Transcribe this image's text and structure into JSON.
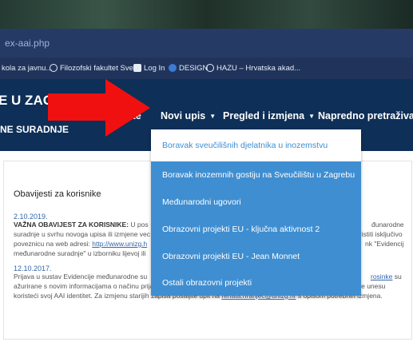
{
  "browser": {
    "url_fragment": "ex-aai.php",
    "bookmarks": [
      {
        "label": "kola za javnu...",
        "icon": "bookmark-icon"
      },
      {
        "label": "Filozofski fakultet Sve...",
        "icon": "globe-icon"
      },
      {
        "label": "Log In",
        "icon": "login-page-icon"
      },
      {
        "label": "DESIGN",
        "icon": "design-icon"
      },
      {
        "label": "HAZU – Hrvatska akad...",
        "icon": "hazu-icon"
      }
    ]
  },
  "header": {
    "title": "E U ZAGREB",
    "subtitle": "NE SURADNJE",
    "nav": {
      "partial": "ute",
      "novi_upis": "Novi upis",
      "pregled": "Pregled i izmjena",
      "napredno": "Napredno pretraživanje"
    }
  },
  "dropdown": {
    "items": [
      "Boravak sveučilišnih djelatnika u inozemstvu",
      "Boravak inozemnih gostiju na Sveučilištu u Zagrebu",
      "Međunarodni ugovori",
      "Obrazovni projekti EU - ključna aktivnost 2",
      "Obrazovni projekti EU - Jean Monnet",
      "Ostali obrazovni projekti"
    ]
  },
  "notices": {
    "title": "Obavijesti za korisnike",
    "n1": {
      "date": "2.10.2019.",
      "bold": "VAŽNA OBAVIJEST ZA KORISNIKE:",
      "line1_rest": " U pos",
      "line1_right": "đunarodne",
      "line2_left": "suradnje u svrhu novoga upisa ili izmjene vec",
      "line2_right": "oristiti isključivo",
      "line3_left": "poveznicu na web adresi: ",
      "line3_link": "http://www.unizg.h",
      "line3_right": "nk \"Evidencija",
      "line4": "međunarodne suradnje\" u izborniku lijevoj ili"
    },
    "n2": {
      "date": "12.10.2017.",
      "line1_left": "Prijava u sustav Evidencije međunarodne su",
      "line1_link": "rosinke",
      "line1_right": " su",
      "line2": "ažurirane s novim informacijama o načinu prijave. Korisnici će biti u mogućnosti samostalno izmijeniti sve zapise koje unesu",
      "line3_left": "koristeći svoj AAI identitet. Za izmjenu starijih zapisa pošaljite upit na ",
      "line3_link": "renata.hranjec@unizg.hr",
      "line3_right": " s opisom potrebnih izmjena."
    }
  },
  "colors": {
    "header": "#0e2f57",
    "dropdown": "#3f8ed1",
    "arrow": "#f01010",
    "link": "#3366a8"
  }
}
